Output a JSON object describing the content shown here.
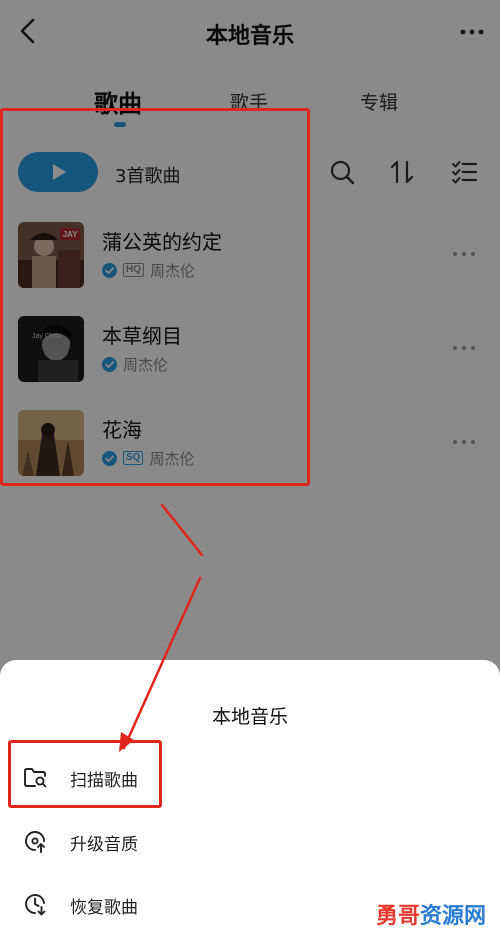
{
  "header": {
    "title": "本地音乐",
    "back_icon": "chevron-left-icon",
    "more_icon": "more-horizontal-icon"
  },
  "tabs": [
    {
      "label": "歌曲",
      "active": true
    },
    {
      "label": "歌手",
      "active": false
    },
    {
      "label": "专辑",
      "active": false
    }
  ],
  "toolbar": {
    "play_icon": "play-icon",
    "song_count": "3首歌曲",
    "icons": [
      "search-icon",
      "sort-icon",
      "multi-select-icon"
    ]
  },
  "songs": [
    {
      "title": "蒲公英的约定",
      "quality": "HQ",
      "artist": "周杰伦",
      "cover_text": "JAY"
    },
    {
      "title": "本草纲目",
      "quality": "",
      "artist": "周杰伦",
      "cover_text": "Jay Chou"
    },
    {
      "title": "花海",
      "quality": "SQ",
      "artist": "周杰伦",
      "cover_text": ""
    }
  ],
  "sheet": {
    "title": "本地音乐",
    "items": [
      {
        "label": "扫描歌曲",
        "icon": "folder-search-icon"
      },
      {
        "label": "升级音质",
        "icon": "quality-upgrade-icon"
      },
      {
        "label": "恢复歌曲",
        "icon": "clock-restore-icon"
      }
    ]
  },
  "colors": {
    "accent": "#2b9fe6",
    "annotation": "#e0261a",
    "overlay": "rgba(0,0,0,0.46)"
  },
  "watermark": {
    "part1": "勇哥",
    "part2": "资源网"
  }
}
